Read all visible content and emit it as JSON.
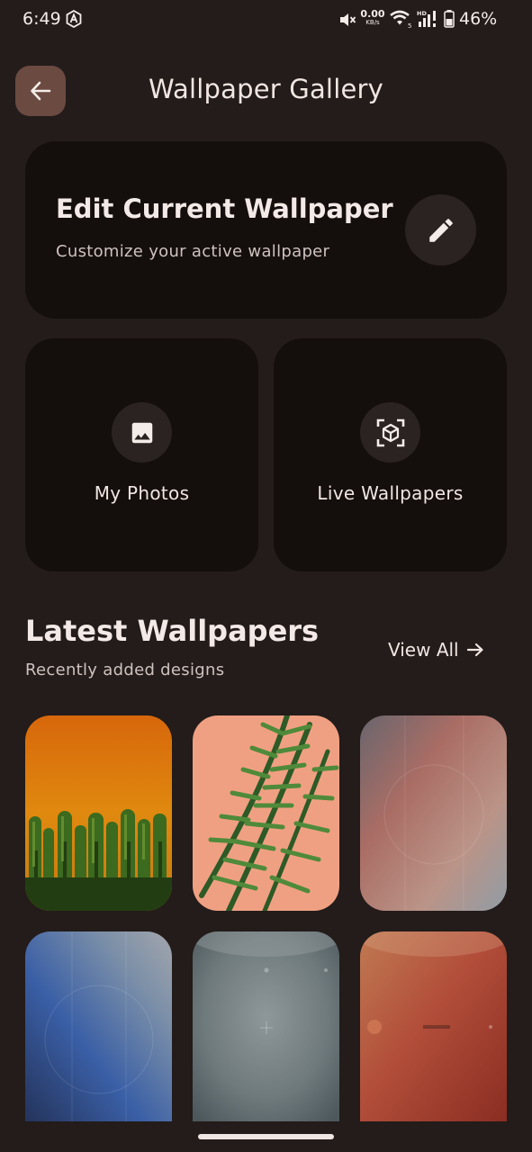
{
  "status_bar": {
    "time": "6:49",
    "net_speed_value": "0.00",
    "net_speed_unit": "KB/s",
    "battery_percent": "46%",
    "icons": [
      "a-badge-icon",
      "mute-icon",
      "wifi-icon",
      "signal-icon",
      "battery-icon"
    ]
  },
  "header": {
    "title": "Wallpaper Gallery",
    "back_icon": "arrow-left-icon"
  },
  "edit_card": {
    "title": "Edit Current Wallpaper",
    "subtitle": "Customize your active wallpaper",
    "icon": "pencil-icon"
  },
  "tiles": [
    {
      "label": "My Photos",
      "icon": "image-icon"
    },
    {
      "label": "Live Wallpapers",
      "icon": "cube-scan-icon"
    }
  ],
  "latest": {
    "title": "Latest Wallpapers",
    "subtitle": "Recently added designs",
    "view_all_label": "View All",
    "view_all_icon": "arrow-right-icon"
  },
  "colors": {
    "background": "#231c1a",
    "card": "#140e0d",
    "icon_circle": "#2a2321",
    "back_button": "#6b4a41",
    "text": "#f1e6e2"
  }
}
